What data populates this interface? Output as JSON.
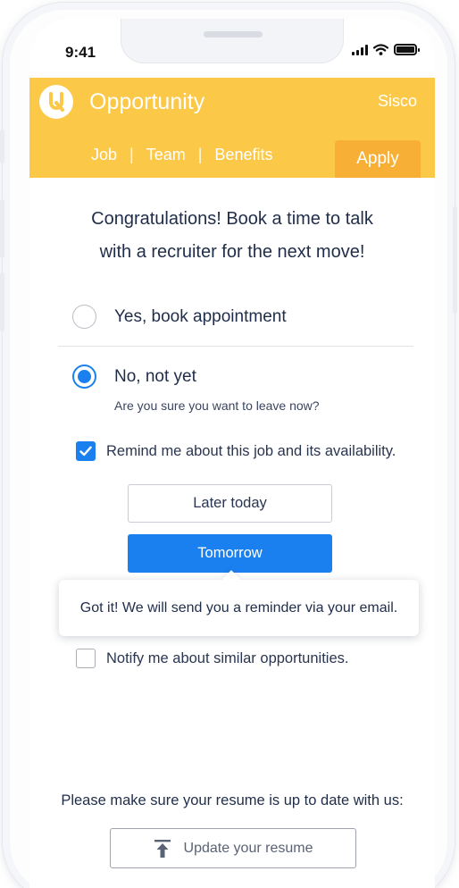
{
  "status_bar": {
    "time": "9:41"
  },
  "header": {
    "app_title": "Opportunity",
    "company": "Sisco",
    "tabs": [
      {
        "label": "Job"
      },
      {
        "label": "Team"
      },
      {
        "label": "Benefits"
      }
    ],
    "tab_separator": "|",
    "apply_label": "Apply"
  },
  "colors": {
    "header_bg": "#fbc847",
    "apply_tab_bg": "#f7b035",
    "accent": "#1a80f0"
  },
  "headline": {
    "line1": "Congratulations! Book a time to talk",
    "line2": "with a recruiter for the next move!"
  },
  "options": {
    "yes_label": "Yes, book appointment",
    "no_label": "No, not yet",
    "no_subtext": "Are you sure you want to leave now?",
    "selected": "no"
  },
  "remind": {
    "label": "Remind me about this job and its availability.",
    "checked": true,
    "later_label": "Later today",
    "tomorrow_label": "Tomorrow"
  },
  "toast": {
    "message": "Got it! We will send you a reminder via your email."
  },
  "notify": {
    "label": "Notify me about similar opportunities.",
    "checked": false
  },
  "resume": {
    "note": "Please make sure your resume is up to date with us:",
    "button_label": "Update your resume"
  },
  "icons": {
    "logo": "app-logo-icon",
    "signal": "cellular-signal-icon",
    "wifi": "wifi-icon",
    "battery": "battery-icon",
    "upload": "upload-icon",
    "check": "checkmark-icon"
  }
}
